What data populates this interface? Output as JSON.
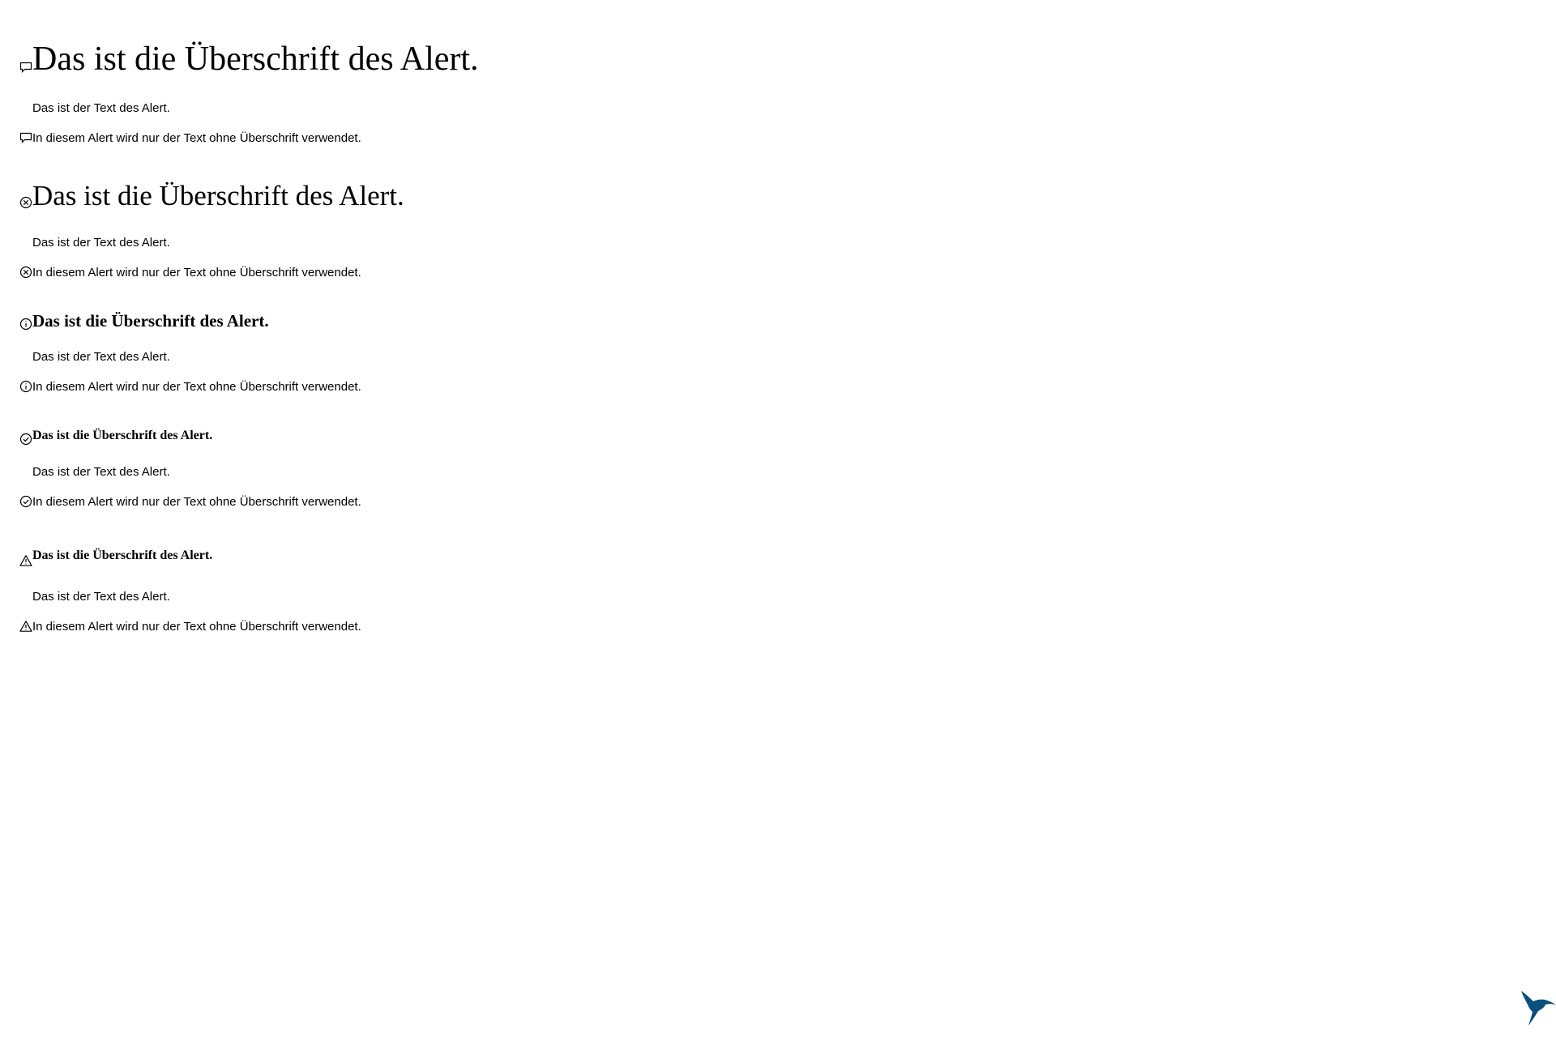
{
  "alerts": [
    {
      "icon": "comment-icon",
      "heading": "Das ist die Überschrift des Alert.",
      "text": "Das ist der Text des Alert.",
      "text_only": "In diesem Alert wird nur der Text ohne Überschrift verwendet."
    },
    {
      "icon": "error-icon",
      "heading": "Das ist die Überschrift des Alert.",
      "text": "Das ist der Text des Alert.",
      "text_only": "In diesem Alert wird nur der Text ohne Überschrift verwendet."
    },
    {
      "icon": "info-icon",
      "heading": "Das ist die Überschrift des Alert.",
      "text": "Das ist der Text des Alert.",
      "text_only": "In diesem Alert wird nur der Text ohne Überschrift verwendet."
    },
    {
      "icon": "success-icon",
      "heading": "Das ist die Überschrift des Alert.",
      "text": "Das ist der Text des Alert.",
      "text_only": "In diesem Alert wird nur der Text ohne Überschrift verwendet."
    },
    {
      "icon": "warning-icon",
      "heading": "Das ist die Überschrift des Alert.",
      "text": "Das ist der Text des Alert.",
      "text_only": "In diesem Alert wird nur der Text ohne Überschrift verwendet."
    }
  ],
  "logo": {
    "icon": "hummingbird-logo-icon",
    "color": "#0b4f7e"
  }
}
